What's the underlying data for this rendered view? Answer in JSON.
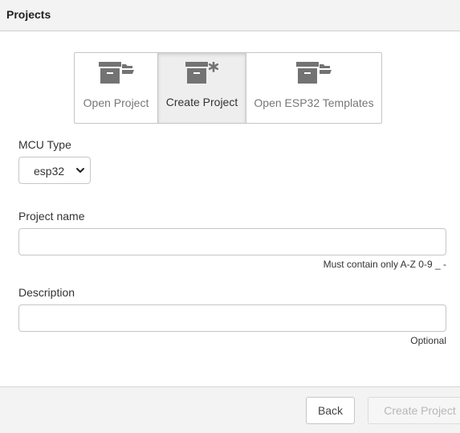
{
  "header": {
    "title": "Projects"
  },
  "modes": [
    {
      "label": "Open Project",
      "icon": "archive-folder-icon"
    },
    {
      "label": "Create Project",
      "icon": "archive-asterisk-icon"
    },
    {
      "label": "Open ESP32 Templates",
      "icon": "archive-folder-icon"
    }
  ],
  "form": {
    "mcu_label": "MCU Type",
    "mcu_value": "esp32",
    "name_label": "Project name",
    "name_value": "",
    "name_hint": "Must contain only A-Z 0-9 _ -",
    "desc_label": "Description",
    "desc_value": "",
    "desc_hint": "Optional"
  },
  "footer": {
    "back_label": "Back",
    "create_label": "Create Project"
  },
  "colors": {
    "icon": "#737373",
    "selected_bg": "#eeeeee",
    "disabled_text": "#b7b7b7"
  }
}
